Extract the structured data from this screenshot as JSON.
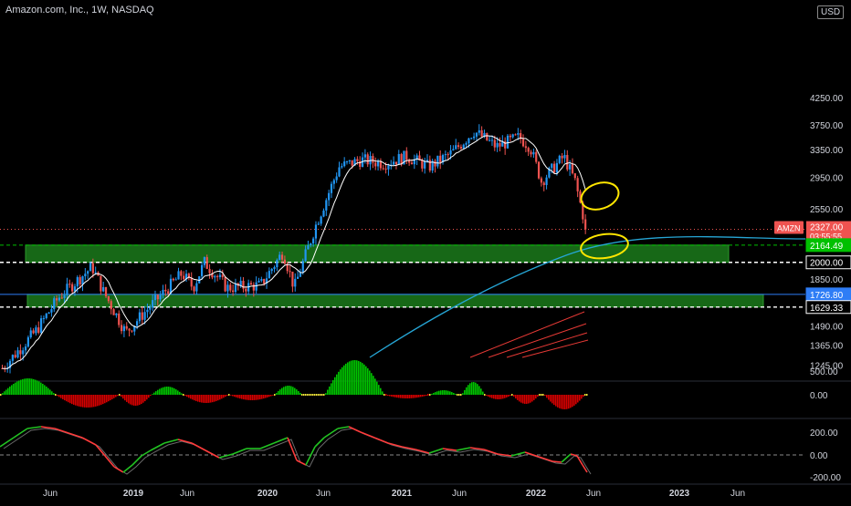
{
  "header": {
    "title": "Amazon.com, Inc., 1W, NASDAQ",
    "currency": "USD"
  },
  "colors": {
    "background": "#000000",
    "up_candle": "#2196f3",
    "down_candle": "#ef5350",
    "zone_fill": "#1b7a1b",
    "sma_line": "#ffffff",
    "long_ma_line": "#26a6d6",
    "regression_lines": "#e53935",
    "histogram_green": "#00c400",
    "histogram_red": "#d40000",
    "oscillator_green": "#22c322",
    "oscillator_red": "#ff3b3b",
    "highlight_circle": "#ffe600",
    "label_price": "#ef5350",
    "label_level_green": "#00c000",
    "label_level_blue": "#2e7df6"
  },
  "chart_data": [
    {
      "type": "candlestick",
      "title": "Amazon.com, Inc., 1W, NASDAQ",
      "x_ticks": [
        "Jun",
        "2019",
        "Jun",
        "2020",
        "Jun",
        "2021",
        "Jun",
        "2022",
        "Jun",
        "2023",
        "Jun"
      ],
      "y_ticks": [
        "4250.00",
        "3750.00",
        "3350.00",
        "2950.00",
        "2550.00",
        "1850.00",
        "1490.00",
        "1365.00",
        "1245.00"
      ],
      "ylim": [
        1100,
        4250
      ],
      "scale": "log",
      "series_close_path": [
        {
          "date": "2018-01",
          "close": 1230
        },
        {
          "date": "2018-04",
          "close": 1460
        },
        {
          "date": "2018-06",
          "close": 1700
        },
        {
          "date": "2018-09",
          "close": 1960
        },
        {
          "date": "2018-10",
          "close": 1750
        },
        {
          "date": "2018-12",
          "close": 1450
        },
        {
          "date": "2019-02",
          "close": 1620
        },
        {
          "date": "2019-05",
          "close": 1900
        },
        {
          "date": "2019-06",
          "close": 1780
        },
        {
          "date": "2019-07",
          "close": 2000
        },
        {
          "date": "2019-09",
          "close": 1780
        },
        {
          "date": "2019-12",
          "close": 1800
        },
        {
          "date": "2020-02",
          "close": 2100
        },
        {
          "date": "2020-03",
          "close": 1780
        },
        {
          "date": "2020-05",
          "close": 2400
        },
        {
          "date": "2020-07",
          "close": 3100
        },
        {
          "date": "2020-09",
          "close": 3200
        },
        {
          "date": "2020-11",
          "close": 3150
        },
        {
          "date": "2021-01",
          "close": 3250
        },
        {
          "date": "2021-03",
          "close": 3100
        },
        {
          "date": "2021-05",
          "close": 3300
        },
        {
          "date": "2021-07",
          "close": 3650
        },
        {
          "date": "2021-09",
          "close": 3400
        },
        {
          "date": "2021-11",
          "close": 3550
        },
        {
          "date": "2021-12",
          "close": 3400
        },
        {
          "date": "2022-01",
          "close": 2900
        },
        {
          "date": "2022-03",
          "close": 3250
        },
        {
          "date": "2022-04",
          "close": 2900
        },
        {
          "date": "2022-05",
          "close": 2327
        }
      ],
      "zones": [
        {
          "name": "upper-zone",
          "from": 2000,
          "to": 2164.49
        },
        {
          "name": "lower-zone",
          "from": 1629.33,
          "to": 1726.8
        }
      ],
      "price_labels": [
        {
          "symbol": "AMZN",
          "value": "2327.00",
          "timer": "03:55:55"
        },
        {
          "value": "2164.49"
        },
        {
          "value": "2000.00"
        },
        {
          "value": "1726.80"
        },
        {
          "value": "1629.33"
        }
      ]
    },
    {
      "type": "bar",
      "name": "histogram-pane",
      "y_ticks": [
        "500.00",
        "0.00"
      ]
    },
    {
      "type": "line",
      "name": "oscillator-pane",
      "y_ticks": [
        "200.00",
        "0.00",
        "-200.00"
      ]
    }
  ]
}
